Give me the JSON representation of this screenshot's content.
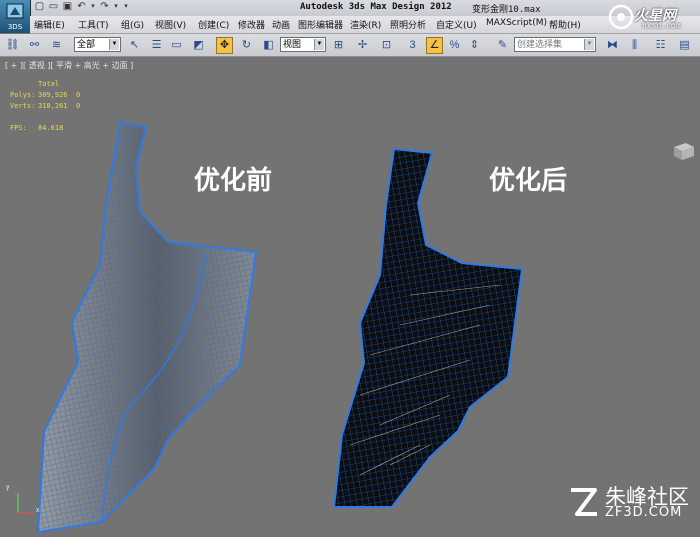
{
  "app": {
    "logo_text": "3DS",
    "title": "Autodesk 3ds Max Design 2012",
    "file": "变形金刚10.max"
  },
  "menu": [
    "编辑(E)",
    "工具(T)",
    "组(G)",
    "视图(V)",
    "创建(C)",
    "修改器",
    "动画",
    "图形编辑器",
    "渲染(R)",
    "照明分析",
    "自定义(U)",
    "MAXScript(M)",
    "帮助(H)"
  ],
  "toolbar": {
    "selection_filter": "全部",
    "reference_coord": "视图",
    "named_selection": "创建选择集",
    "snap_value": "3",
    "percent_snap": "%",
    "active_color": "#f5c24a"
  },
  "viewport": {
    "label": "[ + ][ 透视 ][ 平滑 + 高光 + 边面 ]",
    "stats": {
      "header": "Total",
      "polys_label": "Polys:",
      "polys_value": "309,926",
      "polys_sel": "0",
      "verts_label": "Verts:",
      "verts_value": "318,261",
      "verts_sel": "0",
      "fps_label": "FPS:",
      "fps_value": "84.618"
    },
    "before_label": "优化前",
    "after_label": "优化后",
    "axis_y": "y",
    "axis_x": "x",
    "wire_color": "#2a6fd4",
    "background": "#737373"
  },
  "watermarks": {
    "top_main": "火星网",
    "top_sub": "hxsd.com",
    "bottom_main": "朱峰社区",
    "bottom_sub": "ZF3D.COM"
  }
}
